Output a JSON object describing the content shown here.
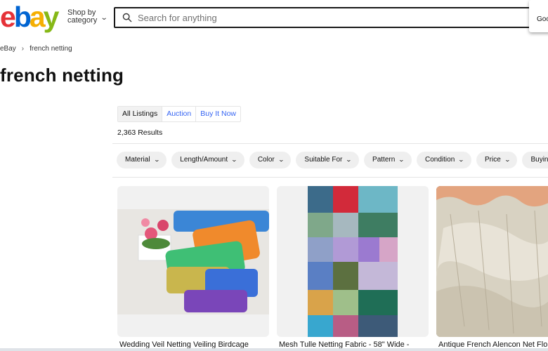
{
  "header": {
    "logo_letters": [
      {
        "char": "e",
        "color": "#e53238"
      },
      {
        "char": "b",
        "color": "#0064d2"
      },
      {
        "char": "a",
        "color": "#f5af02"
      },
      {
        "char": "y",
        "color": "#86b817"
      }
    ],
    "shop_by_line1": "Shop by",
    "shop_by_line2": "category",
    "search_placeholder": "Search for anything",
    "popup_text": "Goo"
  },
  "breadcrumb": {
    "home": "eBay",
    "current": "french netting"
  },
  "page_title": "french netting",
  "tabs": [
    {
      "label": "All Listings",
      "active": true
    },
    {
      "label": "Auction",
      "active": false
    },
    {
      "label": "Buy It Now",
      "active": false
    }
  ],
  "results_count": "2,363 Results",
  "filters": [
    {
      "label": "Material"
    },
    {
      "label": "Length/Amount"
    },
    {
      "label": "Color"
    },
    {
      "label": "Suitable For"
    },
    {
      "label": "Pattern"
    },
    {
      "label": "Condition"
    },
    {
      "label": "Price"
    },
    {
      "label": "Buyin"
    }
  ],
  "listings": [
    {
      "title": "Wedding Veil Netting Veiling Birdcage",
      "image": "colorful-veil-netting"
    },
    {
      "title": "Mesh Tulle Netting Fabric - 58\" Wide -",
      "image": "tulle-color-swatches"
    },
    {
      "title": "Antique French Alencon Net Flo",
      "image": "antique-lace-net"
    }
  ],
  "colors": {
    "link_blue": "#3665f3",
    "chip_bg": "#efefef"
  }
}
